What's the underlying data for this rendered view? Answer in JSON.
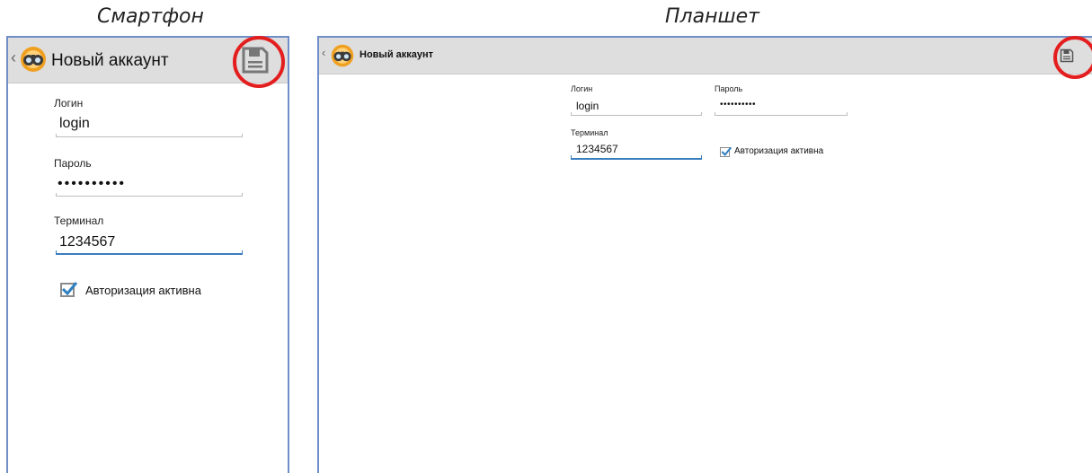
{
  "captions": {
    "phone": "Смартфон",
    "tablet": "Планшет"
  },
  "phone": {
    "title": "Новый аккаунт",
    "fields": {
      "login": {
        "label": "Логин",
        "value": "login"
      },
      "password": {
        "label": "Пароль",
        "value": "••••••••••"
      },
      "terminal": {
        "label": "Терминал",
        "value": "1234567"
      }
    },
    "auth": {
      "label": "Авторизация активна",
      "checked": true
    }
  },
  "tablet": {
    "title": "Новый аккаунт",
    "fields": {
      "login": {
        "label": "Логин",
        "value": "login"
      },
      "password": {
        "label": "Пароль",
        "value": "••••••••••"
      },
      "terminal": {
        "label": "Терминал",
        "value": "1234567"
      }
    },
    "auth": {
      "label": "Авторизация активна",
      "checked": true
    }
  },
  "icons": {
    "back": "chevron-left-icon",
    "logo": "binoculars-logo-icon",
    "save": "floppy-disk-icon",
    "check": "checkmark-icon"
  },
  "colors": {
    "frame_border": "#6f8ec7",
    "actionbar": "#dedede",
    "accent_line": "#3a7dbf",
    "highlight_ring": "#e41e1e",
    "checkmark": "#2f7fc1",
    "logo_orange": "#f0a020"
  }
}
